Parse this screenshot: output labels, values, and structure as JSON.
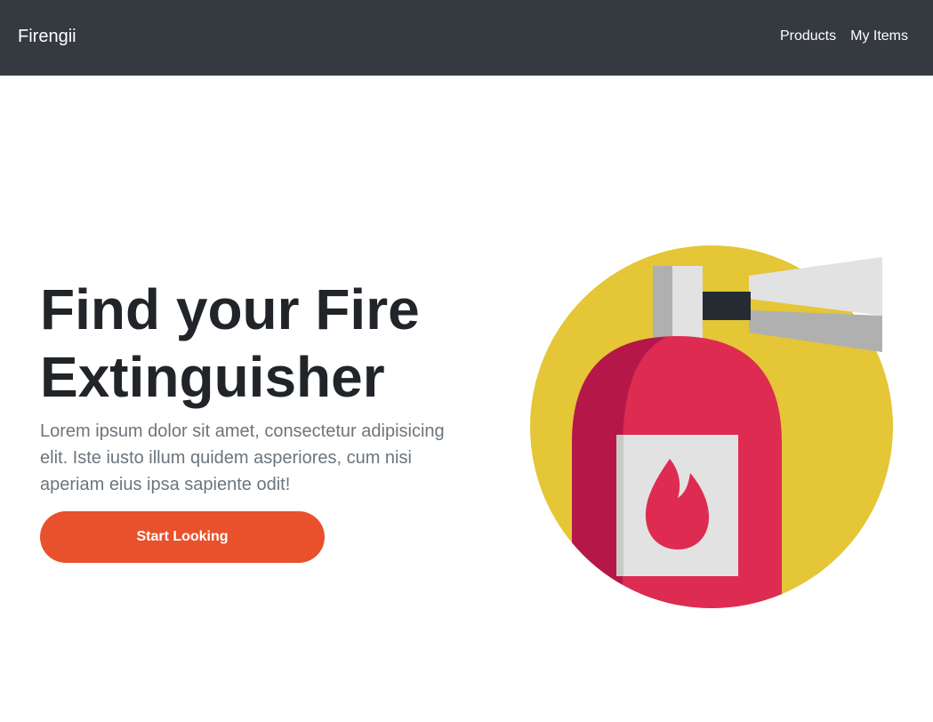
{
  "navbar": {
    "brand": "Firengii",
    "links": [
      "Products",
      "My Items"
    ]
  },
  "hero": {
    "title": "Find your Fire Extinguisher",
    "text": "Lorem ipsum dolor sit amet, consectetur adipisicing elit. Iste iusto illum quidem asperiores, cum nisi aperiam eius ipsa sapiente odit!",
    "button_label": "Start Looking"
  },
  "colors": {
    "navbar": "#343a40",
    "accent": "#e8512c",
    "illustration_circle": "#e4c636",
    "extinguisher_body": "#dd2b51",
    "extinguisher_shadow": "#b51848"
  },
  "illustration": {
    "icon": "fire-extinguisher-icon"
  }
}
